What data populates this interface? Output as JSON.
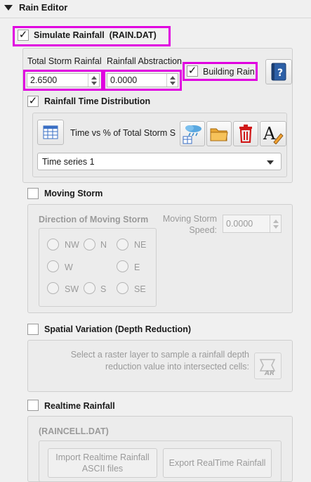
{
  "header": {
    "title": "Rain Editor"
  },
  "simulate": {
    "label": "Simulate Rainfall  (RAIN.DAT)",
    "checked": true
  },
  "storm": {
    "total_label": "Total Storm Rainfal",
    "total_value": "2.6500",
    "abstraction_label": "Rainfall Abstraction",
    "abstraction_value": "0.0000",
    "building_rain_label": "Building Rain"
  },
  "distribution": {
    "label": "Rainfall Time Distribution",
    "table_label": "Time vs % of Total Storm S",
    "series_selected": "Time series 1"
  },
  "moving_storm": {
    "label": "Moving Storm",
    "direction_title": "Direction of Moving Storm",
    "speed_label_line1": "Moving Storm",
    "speed_label_line2": "Speed:",
    "speed_value": "0.0000",
    "directions": {
      "nw": "NW",
      "n": "N",
      "ne": "NE",
      "w": "W",
      "e": "E",
      "sw": "SW",
      "s": "S",
      "se": "SE"
    }
  },
  "spatial": {
    "label": "Spatial Variation (Depth Reduction)",
    "hint_line1": "Select a raster layer to sample a rainfall depth",
    "hint_line2": "reduction value into intersected cells:",
    "ar_icon_text": "AR"
  },
  "realtime": {
    "label": "Realtime Rainfall",
    "raincell_title": "(RAINCELL.DAT)",
    "import_line1": "Import Realtime Rainfall",
    "import_line2": "ASCII files",
    "export_label": "Export RealTime Rainfall"
  },
  "colors": {
    "highlight": "#e000e0",
    "delete_red": "#d01818",
    "folder": "#e8a634",
    "help_blue": "#2c5fa6"
  }
}
